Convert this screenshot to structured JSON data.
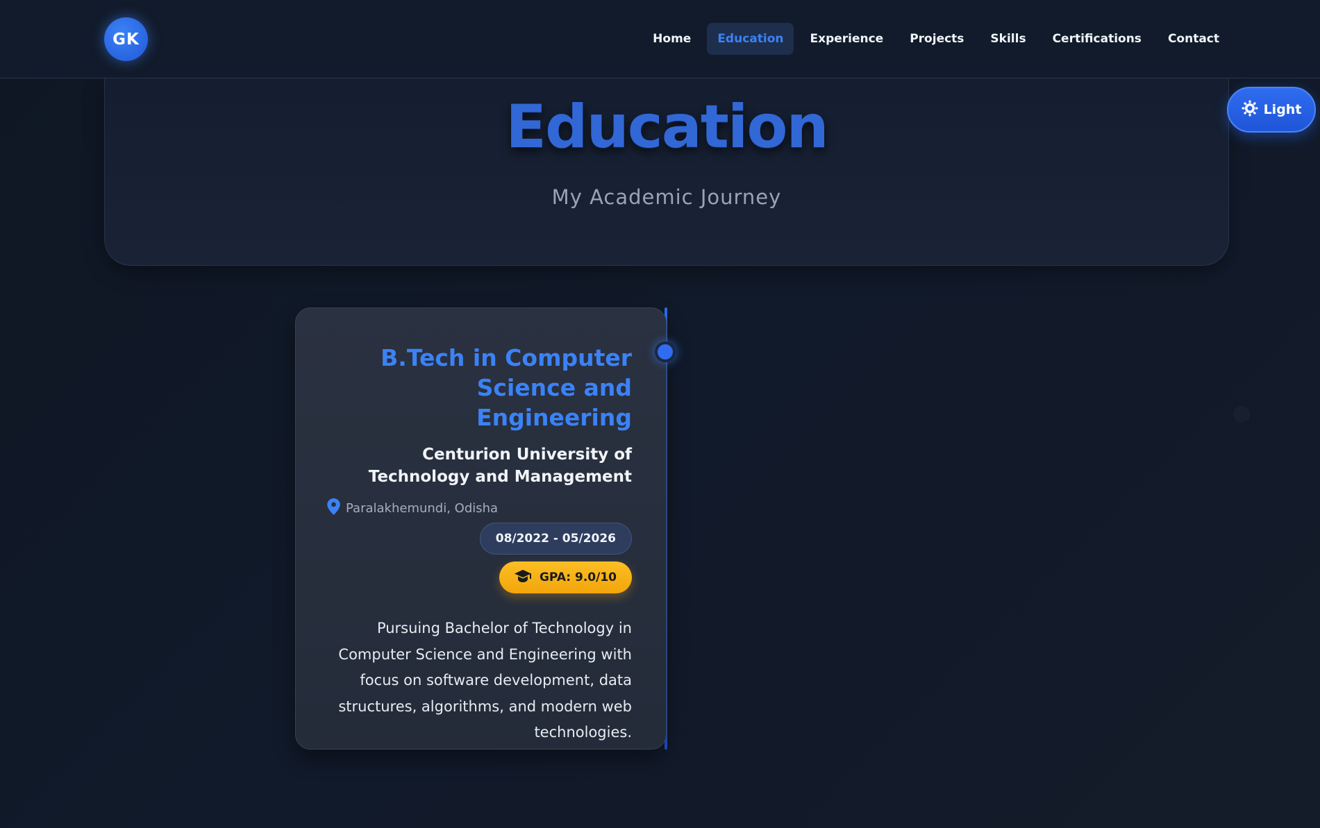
{
  "nav": {
    "logo": "GK",
    "links": [
      "Home",
      "Education",
      "Experience",
      "Projects",
      "Skills",
      "Certifications",
      "Contact"
    ],
    "active": "Education"
  },
  "theme_toggle": {
    "label": "Light",
    "icon": "sun-icon"
  },
  "hero": {
    "title": "Education",
    "subtitle": "My Academic Journey"
  },
  "education": [
    {
      "degree": "B.Tech in Computer Science and Engineering",
      "institution": "Centurion University of Technology and Management",
      "location": "Paralakhemundi, Odisha",
      "dates": "08/2022 - 05/2026",
      "gpa": "GPA: 9.0/10",
      "description": "Pursuing Bachelor of Technology in Computer Science and Engineering with focus on software development, data structures, algorithms, and modern web technologies."
    }
  ],
  "colors": {
    "accent": "#3b82f6",
    "gpa_badge": "#fbbf24",
    "background": "#111a2a",
    "card": "#272e3c"
  }
}
